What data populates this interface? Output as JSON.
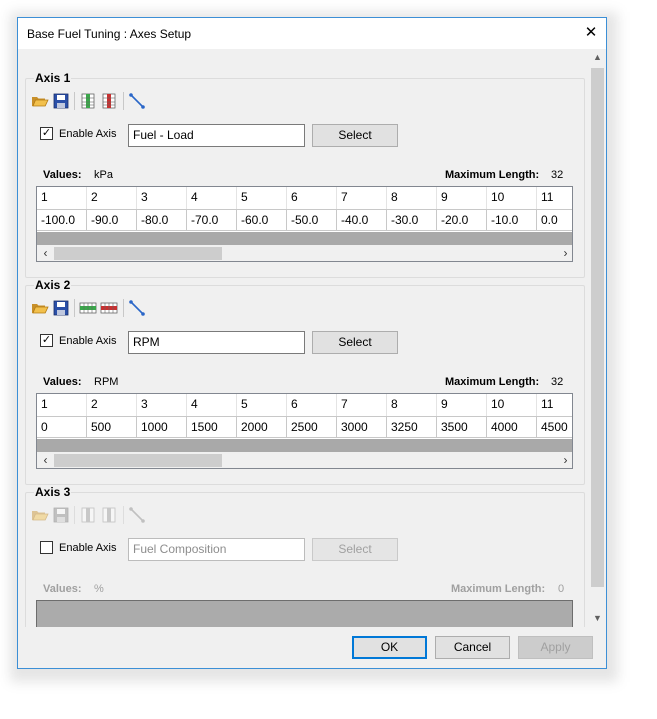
{
  "window": {
    "title": "Base Fuel Tuning : Axes Setup",
    "close_glyph": "✕"
  },
  "axes": [
    {
      "title": "Axis 1",
      "enabled": true,
      "check_glyph": "✓",
      "enable_label": "Enable Axis",
      "input_value": "Fuel - Load",
      "select_label": "Select",
      "values_label": "Values:",
      "unit": "kPa",
      "max_length_label": "Maximum Length:",
      "max_length": "32",
      "columns": [
        "1",
        "2",
        "3",
        "4",
        "5",
        "6",
        "7",
        "8",
        "9",
        "10",
        "11"
      ],
      "values": [
        "-100.0",
        "-90.0",
        "-80.0",
        "-70.0",
        "-60.0",
        "-50.0",
        "-40.0",
        "-30.0",
        "-20.0",
        "-10.0",
        "0.0"
      ],
      "toolbar_icons": [
        "open-icon",
        "save-icon",
        "insert-column-icon",
        "delete-column-icon",
        "interpolate-icon"
      ]
    },
    {
      "title": "Axis 2",
      "enabled": true,
      "check_glyph": "✓",
      "enable_label": "Enable Axis",
      "input_value": "RPM",
      "select_label": "Select",
      "values_label": "Values:",
      "unit": "RPM",
      "max_length_label": "Maximum Length:",
      "max_length": "32",
      "columns": [
        "1",
        "2",
        "3",
        "4",
        "5",
        "6",
        "7",
        "8",
        "9",
        "10",
        "11"
      ],
      "values": [
        "0",
        "500",
        "1000",
        "1500",
        "2000",
        "2500",
        "3000",
        "3250",
        "3500",
        "4000",
        "4500"
      ],
      "toolbar_icons": [
        "open-icon",
        "save-icon",
        "insert-row-icon",
        "delete-row-icon",
        "interpolate-icon"
      ]
    },
    {
      "title": "Axis 3",
      "enabled": false,
      "check_glyph": "",
      "enable_label": "Enable Axis",
      "input_value": "",
      "input_placeholder": "Fuel Composition",
      "select_label": "Select",
      "values_label": "Values:",
      "unit": "%",
      "max_length_label": "Maximum Length:",
      "max_length": "0",
      "toolbar_icons": [
        "open-icon",
        "save-icon",
        "insert-column-icon",
        "delete-column-icon",
        "interpolate-icon"
      ]
    }
  ],
  "scroll": {
    "up_glyph": "▲",
    "down_glyph": "▼",
    "left_glyph": "‹",
    "right_glyph": "›"
  },
  "footer": {
    "ok_label": "OK",
    "cancel_label": "Cancel",
    "apply_label": "Apply"
  },
  "colors": {
    "window_border": "#3c8fd6",
    "default_button_border": "#0078d7",
    "grid_gray": "#a9a9a9"
  }
}
